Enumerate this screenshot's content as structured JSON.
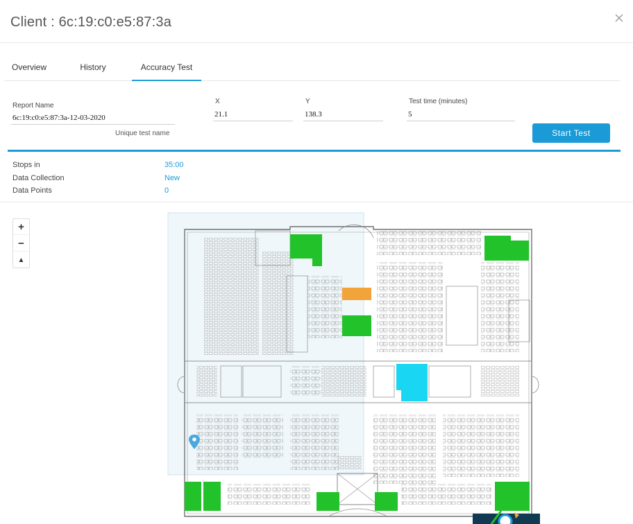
{
  "header": {
    "title": "Client : 6c:19:c0:e5:87:3a"
  },
  "tabs": [
    {
      "label": "Overview"
    },
    {
      "label": "History"
    },
    {
      "label": "Accuracy Test"
    }
  ],
  "form": {
    "report_name_label": "Report Name",
    "report_name_value": "6c:19:c0:e5:87:3a-12-03-2020",
    "report_name_hint": "Unique test name",
    "x_label": "X",
    "x_value": "21.1",
    "y_label": "Y",
    "y_value": "138.3",
    "time_label": "Test time (minutes)",
    "time_value": "5",
    "start_button": "Start Test"
  },
  "stats": [
    {
      "label": "Stops in",
      "value": "35:00"
    },
    {
      "label": "Data Collection",
      "value": "New"
    },
    {
      "label": "Data Points",
      "value": "0"
    }
  ],
  "map": {
    "zoom_in": "+",
    "zoom_out": "−",
    "compass": "▲",
    "accent_color": "#1a9bd7",
    "zone_colors": {
      "green": "#22c22a",
      "orange": "#f2a33a",
      "cyan": "#19d6f2"
    }
  }
}
